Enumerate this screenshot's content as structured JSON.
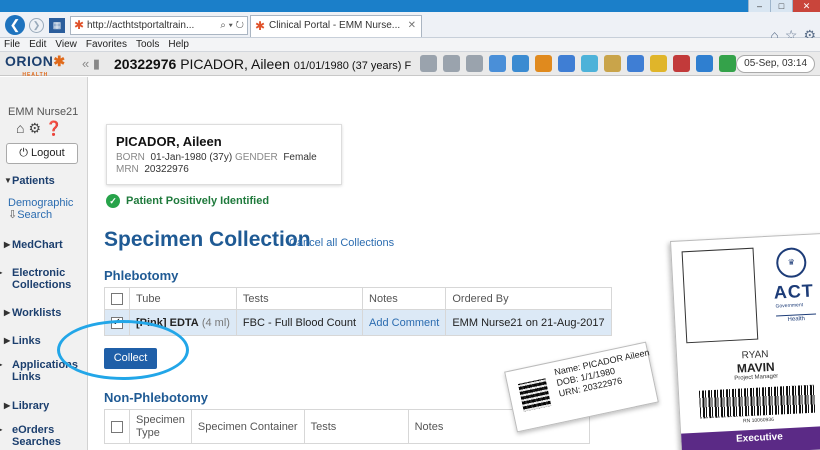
{
  "browser": {
    "address": "http://acthtstportaltrain...",
    "address_tools": "⌕ ▾ ↻",
    "tab_title": "Clinical Portal - EMM Nurse...",
    "menu": [
      "File",
      "Edit",
      "View",
      "Favorites",
      "Tools",
      "Help"
    ]
  },
  "header": {
    "logo": "ORION",
    "logo_sub": "HEALTH",
    "mrn": "20322976",
    "patient_name": "PICADOR, Aileen",
    "dob_age": "01/01/1980 (37 years) F",
    "datetime": "05-Sep, 03:14",
    "icon_colors": [
      "#9aa3ad",
      "#9aa3ad",
      "#9aa3ad",
      "#4a8fd8",
      "#3b8bd1",
      "#e08a1e",
      "#3f7ed4",
      "#4db2d9",
      "#c9a44a",
      "#3f7ed4",
      "#e0b52a",
      "#c23a3a",
      "#2f7fd0",
      "#34a24a",
      "#3a74c8"
    ]
  },
  "sidebar": {
    "user": "EMM Nurse21",
    "user_icons": "⌂⚙❓",
    "logout": "Logout",
    "patients": "Patients",
    "demographic_search_l1": "Demographic",
    "demographic_search_l2": "Search",
    "items": [
      "MedChart",
      "Electronic Collections",
      "Worklists",
      "Links",
      "Applications Links",
      "Library",
      "eOrders Searches"
    ]
  },
  "patient_card": {
    "name": "PICADOR, Aileen",
    "born_label": "BORN",
    "born": "01-Jan-1980 (37y)",
    "gender_label": "GENDER",
    "gender": "Female",
    "mrn_label": "MRN",
    "mrn": "20322976"
  },
  "identified": "Patient Positively Identified",
  "specimen": {
    "title": "Specimen Collection",
    "cancel_all": "Cancel all Collections",
    "phlebotomy": "Phlebotomy",
    "phleb_headers": [
      "Tube",
      "Tests",
      "Notes",
      "Ordered By"
    ],
    "row": {
      "tube_prefix": "[Pink] EDTA",
      "tube_size": "(4 ml)",
      "tests": "FBC - Full Blood Count",
      "notes": "Add Comment",
      "ordered_by": "EMM Nurse21 on 21-Aug-2017"
    },
    "collect": "Collect",
    "non_phlebotomy": "Non-Phlebotomy",
    "non_headers": [
      "Specimen Type",
      "Specimen Container",
      "Tests",
      "Notes"
    ]
  },
  "wristband": {
    "name": "Name: PICADOR  Aileen",
    "dob": "DOB: 1/1/1980",
    "urn": "URN: 20322976"
  },
  "id_badge": {
    "org": "ACT",
    "gov": "Government",
    "dept": "Health",
    "first": "RYAN",
    "last": "MAVIN",
    "role": "Project Manager",
    "number": "RN 10060936",
    "footer": "Executive"
  }
}
